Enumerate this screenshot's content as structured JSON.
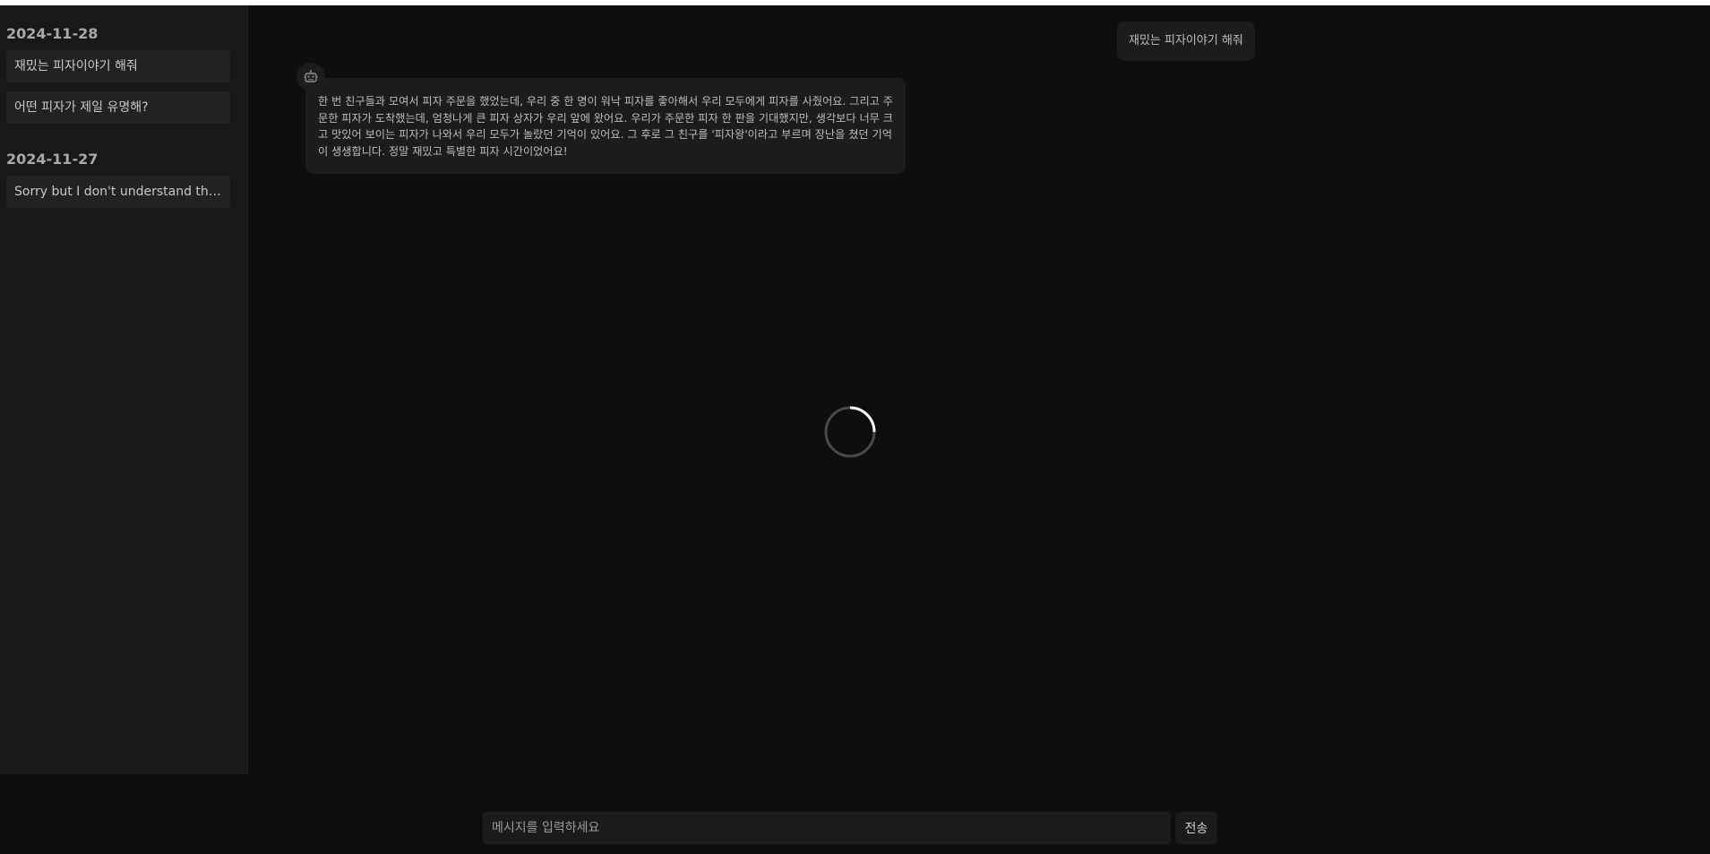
{
  "sidebar": {
    "groups": [
      {
        "date": "2024-11-28",
        "items": [
          {
            "label": "재밌는 피자이야기 해줘"
          },
          {
            "label": "어떤 피자가 제일 유명해?"
          }
        ]
      },
      {
        "date": "2024-11-27",
        "items": [
          {
            "label": "Sorry but I don't understand the ..."
          }
        ]
      }
    ]
  },
  "chat": {
    "user_message": "재밌는 피자이야기 해줘",
    "bot_avatar_icon": "robot-icon",
    "bot_message": "한 번 친구들과 모여서 피자 주문을 했었는데, 우리 중 한 명이 워낙 피자를 좋아해서 우리 모두에게 피자를 사줬어요. 그리고 주문한 피자가 도착했는데, 엄청나게 큰 피자 상자가 우리 앞에 왔어요. 우리가 주문한 피자 한 판을 기대했지만, 생각보다 너무 크고 맛있어 보이는 피자가 나와서 우리 모두가 놀랐던 기억이 있어요. 그 후로 그 친구를 '피자왕'이라고 부르며 장난을 쳤던 기억이 생생합니다. 정말 재밌고 특별한 피자 시간이었어요!",
    "loading_icon": "spinner-icon"
  },
  "composer": {
    "placeholder": "메시지를 입력하세요",
    "value": "",
    "send_label": "전송"
  },
  "colors": {
    "background": "#0e0e0e",
    "sidebar": "#181818",
    "bubble": "#1c1c1c",
    "spinner_track": "#4a4a4a",
    "spinner_arc": "#ffffff"
  }
}
